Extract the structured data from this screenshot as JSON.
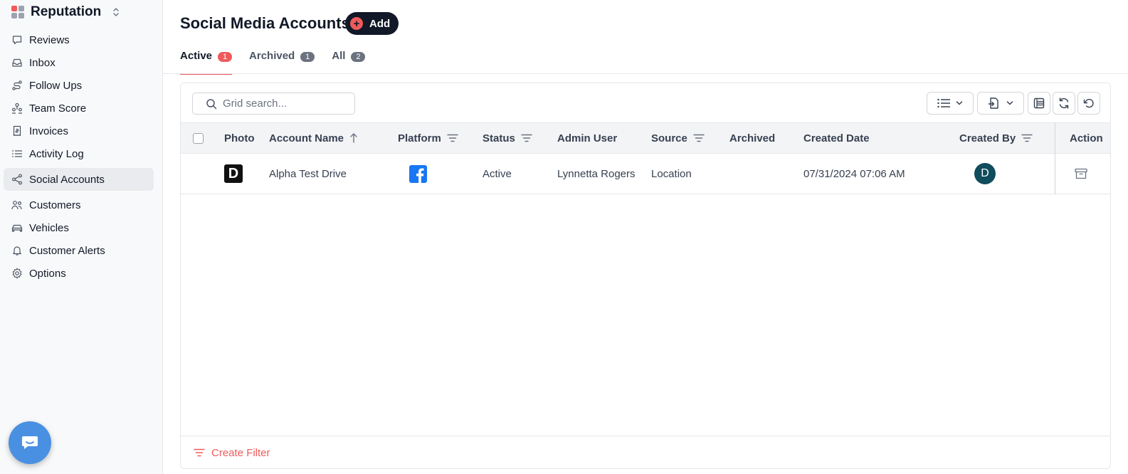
{
  "app": {
    "name": "Reputation"
  },
  "sidebar": {
    "items": [
      {
        "label": "Reviews",
        "icon": "message-square-icon"
      },
      {
        "label": "Inbox",
        "icon": "inbox-icon"
      },
      {
        "label": "Follow Ups",
        "icon": "route-icon"
      },
      {
        "label": "Team Score",
        "icon": "team-icon"
      },
      {
        "label": "Invoices",
        "icon": "receipt-icon"
      },
      {
        "label": "Activity Log",
        "icon": "list-icon"
      },
      {
        "label": "Social Accounts",
        "icon": "share-icon",
        "active": true
      },
      {
        "label": "Customers",
        "icon": "users-icon"
      },
      {
        "label": "Vehicles",
        "icon": "car-icon"
      },
      {
        "label": "Customer Alerts",
        "icon": "bell-icon"
      },
      {
        "label": "Options",
        "icon": "gear-icon"
      }
    ]
  },
  "header": {
    "title": "Social Media Accounts",
    "add_label": "Add"
  },
  "tabs": [
    {
      "label": "Active",
      "count": "1",
      "active": true
    },
    {
      "label": "Archived",
      "count": "1"
    },
    {
      "label": "All",
      "count": "2"
    }
  ],
  "grid": {
    "search_placeholder": "Grid search...",
    "columns": {
      "photo": "Photo",
      "account_name": "Account Name",
      "platform": "Platform",
      "status": "Status",
      "admin_user": "Admin User",
      "source": "Source",
      "archived": "Archived",
      "created_date": "Created Date",
      "created_by": "Created By",
      "action": "Action"
    },
    "rows": [
      {
        "photo_letter": "D",
        "account_name": "Alpha Test Drive",
        "platform": "facebook-icon",
        "status": "Active",
        "admin_user": "Lynnetta Rogers",
        "source": "Location",
        "archived": "",
        "created_date": "07/31/2024 07:06 AM",
        "created_by_initial": "D"
      }
    ],
    "footer": {
      "create_filter_label": "Create Filter"
    }
  },
  "colors": {
    "accent": "#ef5a5a",
    "dark": "#111827",
    "facebook": "#1877f2",
    "avatar": "#0f4c5c",
    "chat": "#4a90e2"
  }
}
